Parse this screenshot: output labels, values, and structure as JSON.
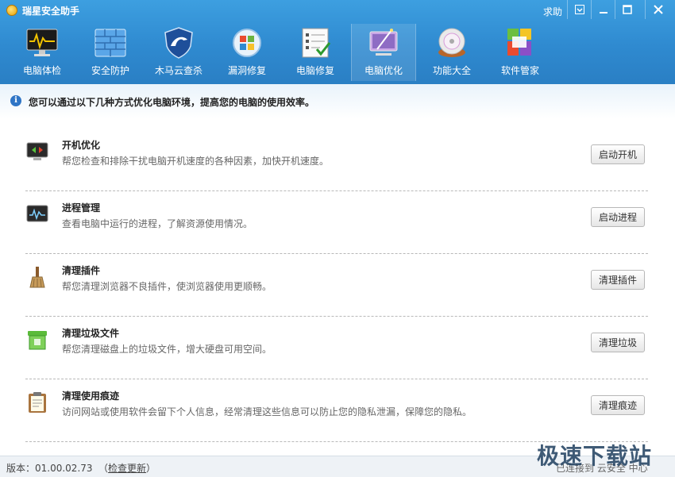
{
  "window": {
    "title": "瑞星安全助手",
    "help": "求助",
    "controls": [
      "menu",
      "minimize",
      "maximize",
      "close"
    ]
  },
  "toolbar": [
    {
      "label": "电脑体检",
      "icon": "monitor-check-icon"
    },
    {
      "label": "安全防护",
      "icon": "firewall-icon"
    },
    {
      "label": "木马云查杀",
      "icon": "shield-icon"
    },
    {
      "label": "漏洞修复",
      "icon": "windows-update-icon"
    },
    {
      "label": "电脑修复",
      "icon": "checklist-icon"
    },
    {
      "label": "电脑优化",
      "icon": "monitor-wand-icon",
      "active": true
    },
    {
      "label": "功能大全",
      "icon": "disc-icon"
    },
    {
      "label": "软件管家",
      "icon": "software-manager-icon"
    }
  ],
  "info": {
    "text": "您可以通过以下几种方式优化电脑环境，提高您的电脑的使用效率。"
  },
  "items": [
    {
      "title": "开机优化",
      "desc": "帮您检查和排除干扰电脑开机速度的各种因素，加快开机速度。",
      "button": "启动开机",
      "icon": "startup-icon"
    },
    {
      "title": "进程管理",
      "desc": "查看电脑中运行的进程，了解资源使用情况。",
      "button": "启动进程",
      "icon": "process-monitor-icon"
    },
    {
      "title": "清理插件",
      "desc": "帮您清理浏览器不良插件，使浏览器使用更顺畅。",
      "button": "清理插件",
      "icon": "broom-icon"
    },
    {
      "title": "清理垃圾文件",
      "desc": "帮您清理磁盘上的垃圾文件，增大硬盘可用空间。",
      "button": "清理垃圾",
      "icon": "trash-bin-icon"
    },
    {
      "title": "清理使用痕迹",
      "desc": "访问网站或使用软件会留下个人信息，经常清理这些信息可以防止您的隐私泄漏，保障您的隐私。",
      "button": "清理痕迹",
      "icon": "clipboard-icon"
    }
  ],
  "status": {
    "version": "版本：01.00.02.73",
    "update_open": "（",
    "update_link": "检查更新",
    "update_close": "）",
    "connection": "已连接到 云安全 中心"
  },
  "watermark": "极速下载站"
}
